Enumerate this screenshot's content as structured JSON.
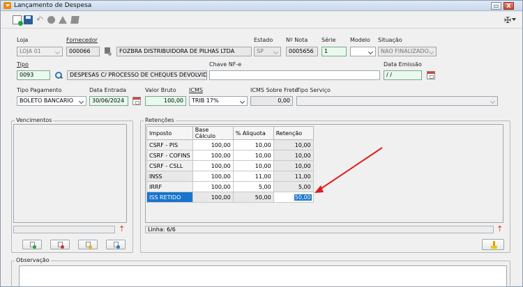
{
  "window": {
    "title": "Lançamento de Despesa",
    "minimize": "▭",
    "close": "X"
  },
  "toolbar": {
    "icons": [
      "new-icon",
      "save-icon",
      "undo-icon",
      "circle-icon",
      "triangle-icon",
      "document-icon",
      "tools-icon"
    ]
  },
  "form": {
    "loja": {
      "label": "Loja",
      "value": "LOJA 01"
    },
    "fornecedor": {
      "label": "Fornecedor",
      "code": "000066",
      "name": "FOZBRA DISTRIBUIDORA DE PILHAS LTDA"
    },
    "estado": {
      "label": "Estado",
      "value": "SP"
    },
    "nota": {
      "label": "Nº Nota",
      "value": "0005656"
    },
    "serie": {
      "label": "Série",
      "value": "1"
    },
    "modelo": {
      "label": "Modelo",
      "value": ""
    },
    "situacao": {
      "label": "Situação",
      "value": "NAO FINALIZADO"
    },
    "tipo": {
      "label": "Tipo",
      "code": "0093",
      "name": "DESPESAS C/ PROCESSO DE CHEQUES DEVOLVID"
    },
    "chave": {
      "label": "Chave NF-e",
      "value": ""
    },
    "data_emissao": {
      "label": "Data Emissão",
      "value": " / /"
    },
    "tipo_pagamento": {
      "label": "Tipo Pagamento",
      "value": "BOLETO BANCARIO"
    },
    "data_entrada": {
      "label": "Data Entrada",
      "value": "30/06/2024"
    },
    "valor_bruto": {
      "label": "Valor Bruto",
      "value": "100,00"
    },
    "icms": {
      "label": "ICMS",
      "value": "TRIB 17%"
    },
    "icms_frete": {
      "label": "ICMS Sobre Frete",
      "value": "0,00"
    },
    "tipo_servico": {
      "label": "Tipo Serviço",
      "value": ""
    }
  },
  "vencimentos": {
    "title": "Vencimentos"
  },
  "retencoes": {
    "title": "Retenções",
    "headers": [
      "Imposto",
      "Base Cálculo",
      "% Aliquota",
      "Retenção"
    ],
    "rows": [
      [
        "CSRF - PIS",
        "100,00",
        "10,00",
        "10,00"
      ],
      [
        "CSRF - COFINS",
        "100,00",
        "10,00",
        "10,00"
      ],
      [
        "CSRF - CSLL",
        "100,00",
        "10,00",
        "10,00"
      ],
      [
        "INSS",
        "100,00",
        "11,00",
        "11,00"
      ],
      [
        "IRRF",
        "100,00",
        "5,00",
        "5,00"
      ],
      [
        "ISS RETIDO",
        "100,00",
        "50,00",
        "50,00"
      ]
    ],
    "status": "Linha: 6/6"
  },
  "observacao": {
    "title": "Observação",
    "value": ""
  },
  "colors": {
    "selection": "#1874cd",
    "arrow": "#e11b1b",
    "required_field": "#e9f9ee"
  }
}
